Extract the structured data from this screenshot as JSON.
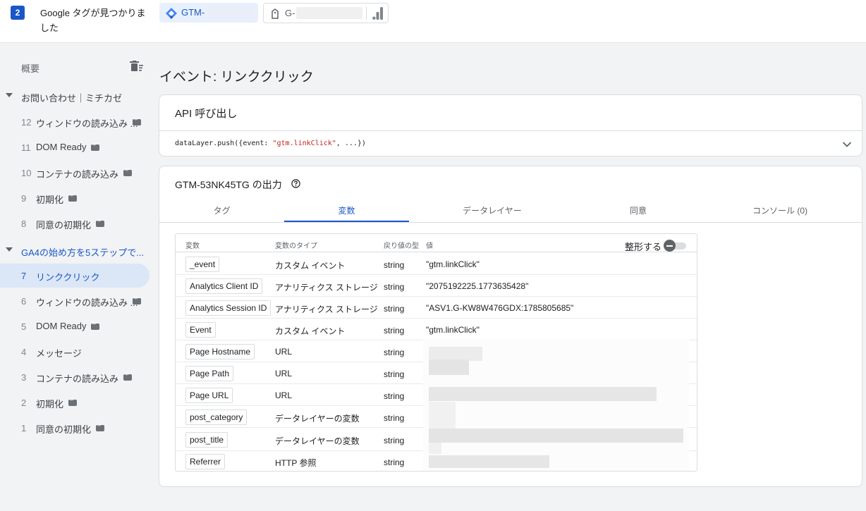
{
  "header": {
    "step_number": "2",
    "found_title": "Google タグが見つかりました",
    "gtm_chip_label": "GTM-",
    "ga_chip_label": "G-"
  },
  "sidebar": {
    "summary_label": "概要",
    "groups": [
      {
        "title": "お問い合わせ｜ミチカゼ",
        "events": [
          {
            "num": "12",
            "name": "ウィンドウの読み込み ...",
            "code": true
          },
          {
            "num": "11",
            "name": "DOM Ready",
            "code": true
          },
          {
            "num": "10",
            "name": "コンテナの読み込み",
            "code": true
          },
          {
            "num": "9",
            "name": "初期化",
            "code": true
          },
          {
            "num": "8",
            "name": "同意の初期化",
            "code": true
          }
        ]
      },
      {
        "title": "GA4の始め方を5ステップで...",
        "events": [
          {
            "num": "7",
            "name": "リンククリック",
            "code": false,
            "active": true
          },
          {
            "num": "6",
            "name": "ウィンドウの読み込み ...",
            "code": true
          },
          {
            "num": "5",
            "name": "DOM Ready",
            "code": true
          },
          {
            "num": "4",
            "name": "メッセージ",
            "code": false
          },
          {
            "num": "3",
            "name": "コンテナの読み込み",
            "code": true
          },
          {
            "num": "2",
            "name": "初期化",
            "code": true
          },
          {
            "num": "1",
            "name": "同意の初期化",
            "code": true
          }
        ]
      }
    ]
  },
  "main": {
    "page_title": "イベント: リンククリック",
    "api_card": {
      "title": "API 呼び出し",
      "code_prefix": "dataLayer.push({event: ",
      "code_string": "\"gtm.linkClick\"",
      "code_suffix": ", ...})"
    },
    "output_card": {
      "title": "GTM-53NK45TG の出力",
      "tabs": [
        "タグ",
        "変数",
        "データレイヤー",
        "同意",
        "コンソール (0)"
      ],
      "active_tab": "変数",
      "table": {
        "headers": [
          "変数",
          "変数のタイプ",
          "戻り値の型",
          "値"
        ],
        "format_label": "整形する",
        "rows": [
          {
            "name": "_event",
            "type": "カスタム イベント",
            "return": "string",
            "value": "\"gtm.linkClick\""
          },
          {
            "name": "Analytics Client ID",
            "type": "アナリティクス ストレージ",
            "return": "string",
            "value": "\"2075192225.1773635428\""
          },
          {
            "name": "Analytics Session ID",
            "type": "アナリティクス ストレージ",
            "return": "string",
            "value": "\"ASV1.G-KW8W476GDX:1785805685\""
          },
          {
            "name": "Event",
            "type": "カスタム イベント",
            "return": "string",
            "value": "\"gtm.linkClick\""
          },
          {
            "name": "Page Hostname",
            "type": "URL",
            "return": "string",
            "value": ""
          },
          {
            "name": "Page Path",
            "type": "URL",
            "return": "string",
            "value": ""
          },
          {
            "name": "Page URL",
            "type": "URL",
            "return": "string",
            "value": ""
          },
          {
            "name": "post_category",
            "type": "データレイヤーの変数",
            "return": "string",
            "value": ""
          },
          {
            "name": "post_title",
            "type": "データレイヤーの変数",
            "return": "string",
            "value": ""
          },
          {
            "name": "Referrer",
            "type": "HTTP 参照",
            "return": "string",
            "value": ""
          }
        ]
      }
    }
  }
}
